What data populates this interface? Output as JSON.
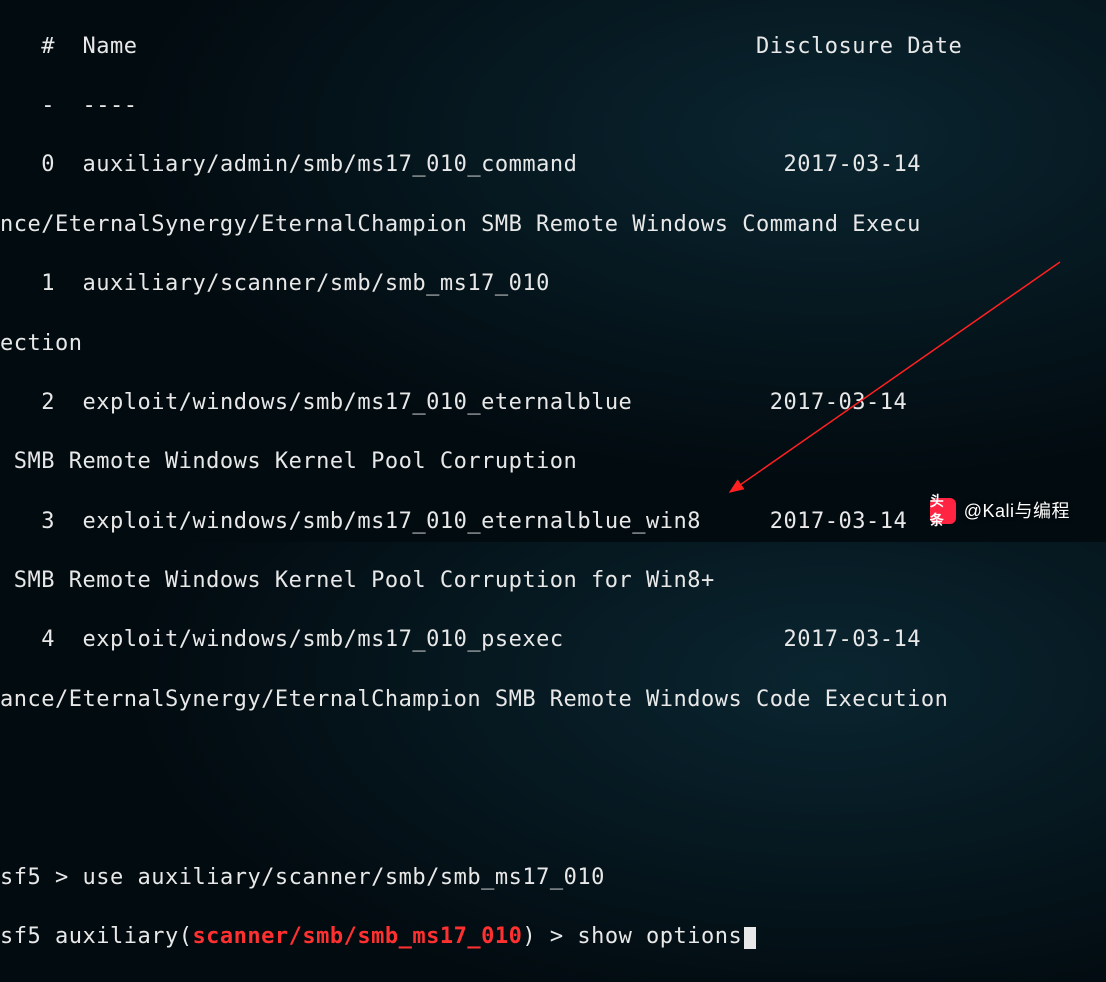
{
  "header": {
    "index_col": "#",
    "name_col": "Name",
    "date_col": "Disclosure Date"
  },
  "divider": {
    "index_col": "-",
    "name_col": "----",
    "date_col": ""
  },
  "results": [
    {
      "idx": "0",
      "name": "auxiliary/admin/smb/ms17_010_command",
      "date": "2017-03-14",
      "desc_wrap": "nce/EternalSynergy/EternalChampion SMB Remote Windows Command Execu"
    },
    {
      "idx": "1",
      "name": "auxiliary/scanner/smb/smb_ms17_010",
      "date": "",
      "desc_wrap": "ection"
    },
    {
      "idx": "2",
      "name": "exploit/windows/smb/ms17_010_eternalblue",
      "date": "2017-03-14",
      "desc_wrap": " SMB Remote Windows Kernel Pool Corruption"
    },
    {
      "idx": "3",
      "name": "exploit/windows/smb/ms17_010_eternalblue_win8",
      "date": "2017-03-14",
      "desc_wrap": " SMB Remote Windows Kernel Pool Corruption for Win8+"
    },
    {
      "idx": "4",
      "name": "exploit/windows/smb/ms17_010_psexec",
      "date": "2017-03-14",
      "desc_wrap": "ance/EternalSynergy/EternalChampion SMB Remote Windows Code Execution"
    }
  ],
  "prompt1": {
    "prefix": "sf5",
    "arrow": " > ",
    "command": "use auxiliary/scanner/smb/smb_ms17_010"
  },
  "prompt2": {
    "prefix": "sf5 ",
    "context_label": "auxiliary(",
    "module": "scanner/smb/smb_ms17_010",
    "context_close": ")",
    "arrow": " > ",
    "command": "show options"
  },
  "watermark": {
    "logo_text": "头条",
    "handle": "@Kali与编程"
  }
}
